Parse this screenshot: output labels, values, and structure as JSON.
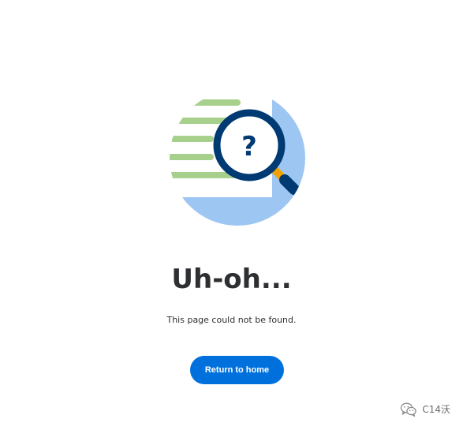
{
  "error": {
    "title": "Uh-oh...",
    "message": "This page could not be found.",
    "button_label": "Return to home"
  },
  "illustration": {
    "icon": "magnifier-question-icon",
    "symbol": "?"
  },
  "watermark": {
    "icon": "wechat-icon",
    "text": "C14沃"
  },
  "colors": {
    "title_text": "#2e2f32",
    "button_background": "#0071dc",
    "button_text": "#ffffff",
    "illustration_blue": "#9dc6f2",
    "illustration_green": "#a8d08d",
    "magnifier_frame": "#003a73",
    "magnifier_handle": "#f0a202"
  }
}
